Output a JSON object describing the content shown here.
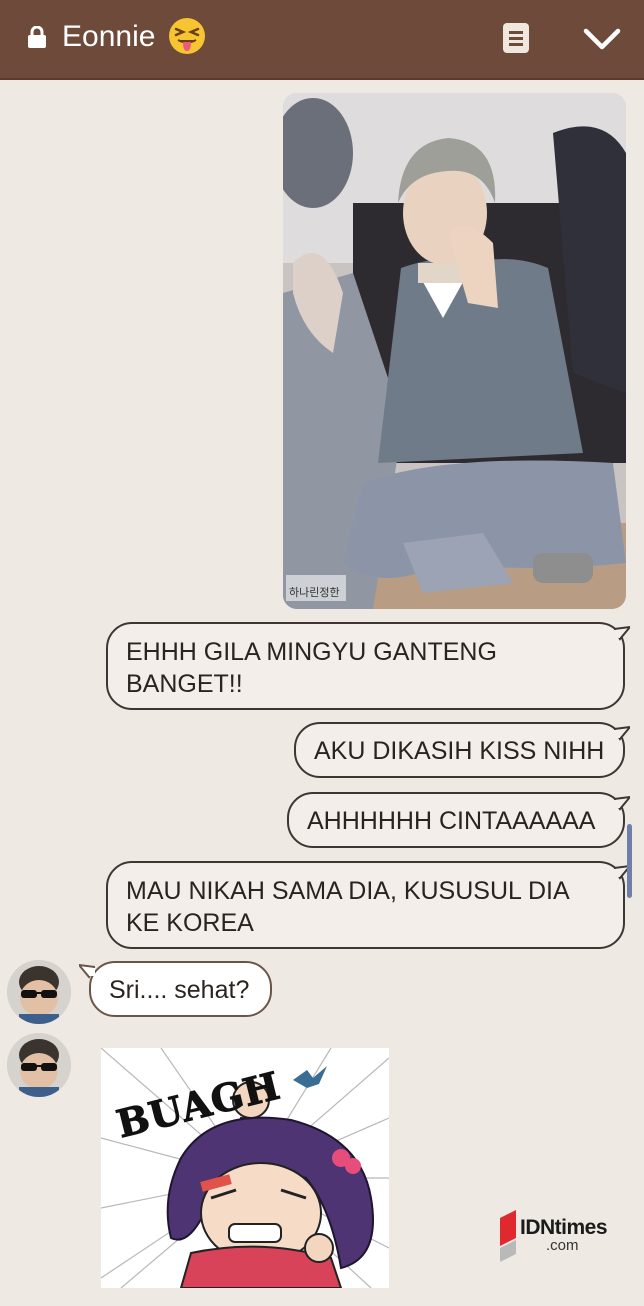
{
  "header": {
    "title": "Eonnie",
    "icons": [
      "lock-icon",
      "squinting-tongue-emoji",
      "notes-icon",
      "chevron-down-icon"
    ],
    "bg_color": "#6e4a3a"
  },
  "messages": [
    {
      "side": "right",
      "type": "image",
      "image_text": "하나린정한"
    },
    {
      "side": "right",
      "type": "text",
      "text": "EHHH GILA MINGYU GANTENG BANGET!!"
    },
    {
      "side": "right",
      "type": "text",
      "text": "AKU DIKASIH KISS NIHH"
    },
    {
      "side": "right",
      "type": "text",
      "text": "AHHHHHH CINTAAAAAA"
    },
    {
      "side": "right",
      "type": "text",
      "text": "MAU NIKAH SAMA DIA, KUSUSUL DIA KE KOREA"
    },
    {
      "side": "left",
      "type": "text",
      "text": "Sri.... sehat?"
    },
    {
      "side": "left",
      "type": "sticker",
      "sticker_text": "BUAGH"
    }
  ],
  "watermark": {
    "brand": "IDNtimes",
    "suffix": ".com"
  }
}
